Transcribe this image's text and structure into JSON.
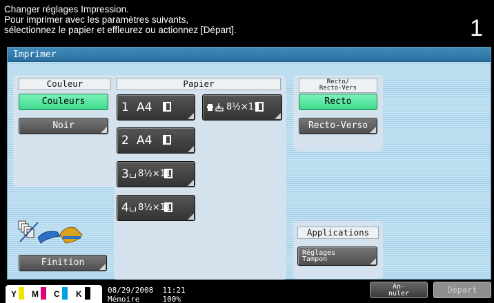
{
  "header": {
    "lines": [
      "Changer réglages Impression.",
      "Pour imprimer avec les paramètres suivants,",
      "sélectionnez le papier et effleurez ou actionnez [Départ]."
    ],
    "copy_count": "1"
  },
  "panel": {
    "title": "Imprimer"
  },
  "couleur": {
    "title": "Couleur",
    "options": [
      {
        "label": "Couleurs",
        "selected": true
      },
      {
        "label": "Noir",
        "selected": false
      }
    ]
  },
  "papier": {
    "title": "Papier",
    "trays": [
      {
        "number": "1",
        "size": "A4",
        "selected": false
      },
      {
        "number": "2",
        "size": "A4",
        "selected": false
      },
      {
        "number": "3",
        "size": "8½×11",
        "selected": false
      },
      {
        "number": "4",
        "size": "8½×11",
        "selected": false
      }
    ],
    "bypass": {
      "size": "8½×11",
      "icon": "hand-bypass-icon"
    }
  },
  "recto_verso": {
    "title_line1": "Recto/",
    "title_line2": "Recto-Vers",
    "options": [
      {
        "label": "Recto",
        "selected": true
      },
      {
        "label": "Recto-Verso",
        "selected": false
      }
    ]
  },
  "finition": {
    "button_label": "Finition",
    "icon": "finisher-staple-punch-icon"
  },
  "applications": {
    "title": "Applications",
    "button_line1": "Réglages",
    "button_line2": "Tampon"
  },
  "footer": {
    "toner": [
      {
        "label": "Y",
        "color": "#f2e600"
      },
      {
        "label": "M",
        "color": "#e0007a"
      },
      {
        "label": "C",
        "color": "#00a0e0"
      },
      {
        "label": "K",
        "color": "#000000"
      }
    ],
    "date": "08/29/2008",
    "time": "11:21",
    "memory_label": "Mémoire",
    "memory_value": "100%",
    "annuler_line1": "An-",
    "annuler_line2": "nuler",
    "depart_label": "Départ"
  },
  "colors": {
    "selected_green": "#4fe39a",
    "title_bar": "#2f7bab",
    "panel_bg": "#bcdcee"
  }
}
